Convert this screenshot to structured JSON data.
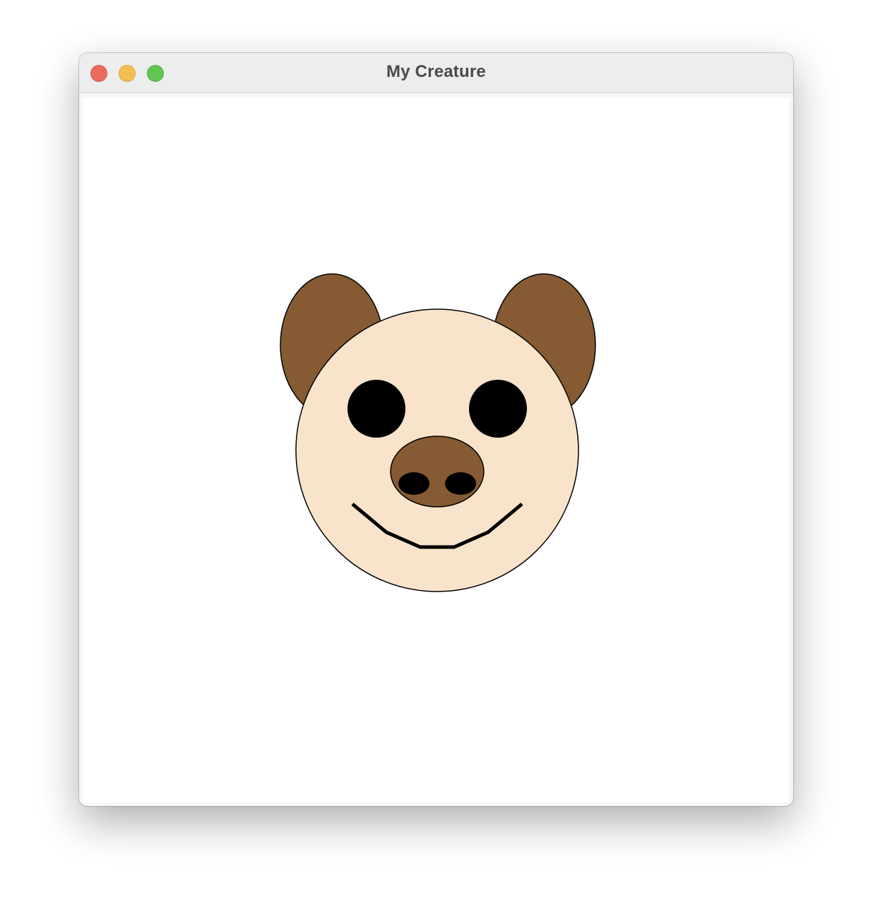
{
  "window": {
    "title": "My Creature"
  },
  "colors": {
    "close": "#ed6a5e",
    "minimize": "#f5bf4f",
    "zoom": "#61c554",
    "ear": "#865b34",
    "face": "#f9e4cb",
    "snout": "#865b34",
    "outline": "#000000",
    "eye": "#000000",
    "nostril": "#000000",
    "mouth": "#000000"
  }
}
